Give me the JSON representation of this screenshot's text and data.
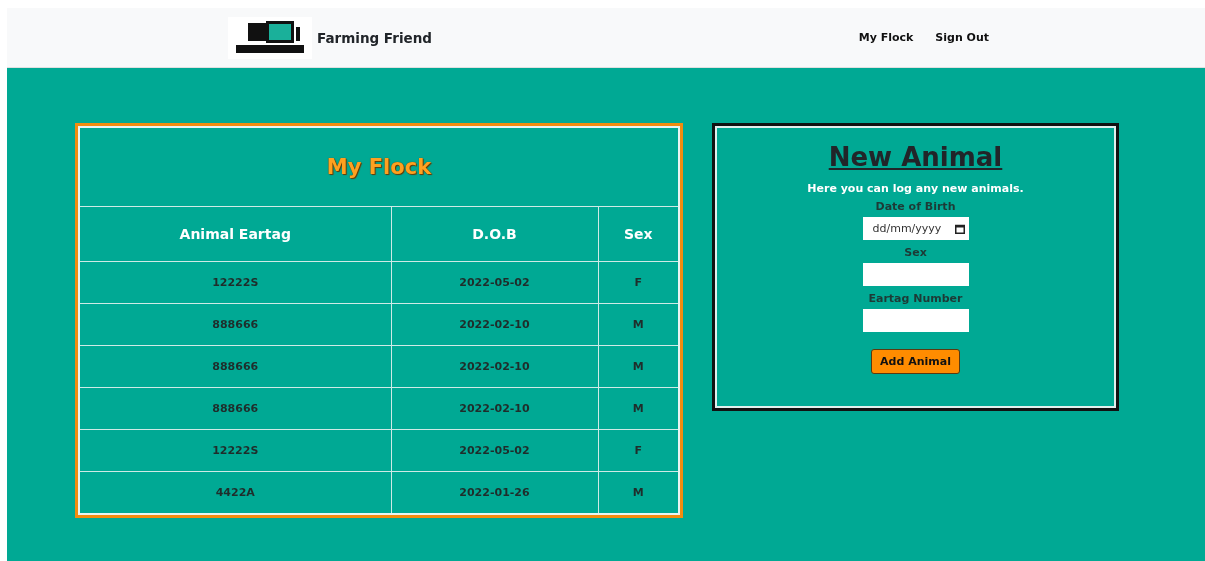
{
  "header": {
    "brand": "Farming Friend",
    "nav": [
      {
        "label": "My Flock"
      },
      {
        "label": "Sign Out"
      }
    ]
  },
  "flock_table": {
    "title": "My Flock",
    "columns": [
      "Animal Eartag",
      "D.O.B",
      "Sex"
    ],
    "rows": [
      [
        "12222S",
        "2022-05-02",
        "F"
      ],
      [
        "888666",
        "2022-02-10",
        "M"
      ],
      [
        "888666",
        "2022-02-10",
        "M"
      ],
      [
        "888666",
        "2022-02-10",
        "M"
      ],
      [
        "12222S",
        "2022-05-02",
        "F"
      ],
      [
        "4422A",
        "2022-01-26",
        "M"
      ]
    ]
  },
  "new_animal_form": {
    "title": "New Animal",
    "intro": "Here you can log any new animals.",
    "fields": [
      {
        "label": "Date of Birth",
        "kind": "date",
        "placeholder": "dd/mm/yyyy"
      },
      {
        "label": "Sex",
        "kind": "text"
      },
      {
        "label": "Eartag Number",
        "kind": "text"
      }
    ],
    "submit": "Add Animal"
  }
}
